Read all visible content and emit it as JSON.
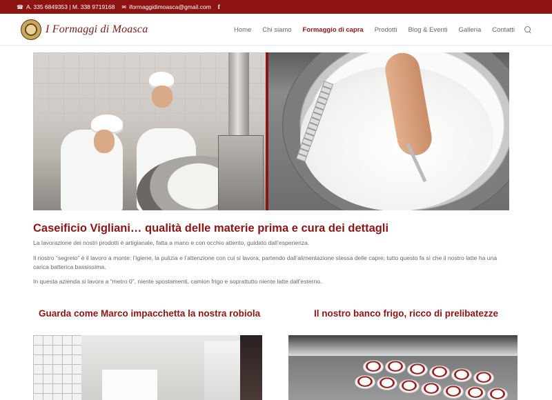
{
  "topbar": {
    "phone_text": "A. 335 6849353 | M. 338 9719168",
    "email": "iformaggidimoasca@gmail.com",
    "facebook_glyph": "f",
    "bg_color": "#8e1414"
  },
  "header": {
    "logo_text": "I Formaggi di Moasca",
    "nav": [
      {
        "label": "Home",
        "active": false
      },
      {
        "label": "Chi siamo",
        "active": false
      },
      {
        "label": "Formaggio di capra",
        "active": true
      },
      {
        "label": "Prodotti",
        "active": false
      },
      {
        "label": "Blog & Eventi",
        "active": false
      },
      {
        "label": "Galleria",
        "active": false
      },
      {
        "label": "Contatti",
        "active": false
      }
    ],
    "accent_color": "#8e1414"
  },
  "main": {
    "title": "Caseificio Vigliani… qualità delle materie prima e cura dei dettagli",
    "paragraphs": [
      "La lavorazione dei nostri prodotti è artigianale, fatta a mano e con occhio attento, guidato dall’esperienza.",
      "Il nostro “segreto” è il lavoro a monte: l’igiene, la pulizia e l’attenzione con cui si lavora, partendo dall’alimentazione stessa delle capre; tutto questo fa sì che il nostro latte ha una carica batterica bassissima.",
      "In questa azienda si lavora a “metro 0”, niente spostamenti, camion frigo e soprattutto niente latte dall’esterno."
    ],
    "section_left_title": "Guarda come Marco impacchetta la nostra robiola",
    "section_right_title": "Il nostro banco frigo, ricco di prelibatezze"
  }
}
